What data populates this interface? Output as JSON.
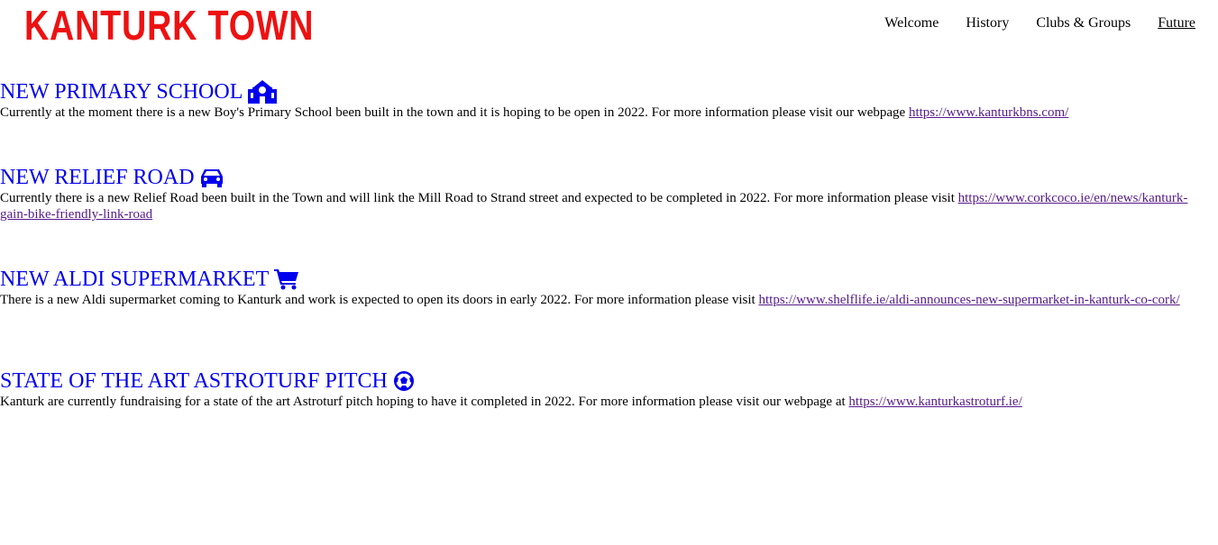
{
  "header": {
    "logo": "KANTURK TOWN",
    "nav": [
      {
        "label": "Welcome"
      },
      {
        "label": "History"
      },
      {
        "label": "Clubs & Groups"
      },
      {
        "label": "Future"
      }
    ]
  },
  "sections": [
    {
      "title": "NEW PRIMARY SCHOOL",
      "icon": "school-icon",
      "text": "Currently at the moment there is a new Boy's Primary School been built in the town and it is hoping to be open in 2022. For more information please visit our webpage ",
      "link": "https://www.kanturkbns.com/"
    },
    {
      "title": "NEW RELIEF ROAD",
      "icon": "car-icon",
      "text": "Currently there is a new Relief Road been built in the Town and will link the Mill Road to Strand street and expected to be completed in 2022. For more information please visit ",
      "link": "https://www.corkcoco.ie/en/news/kanturk-gain-bike-friendly-link-road"
    },
    {
      "title": "NEW ALDI SUPERMARKET",
      "icon": "shopping-cart-icon",
      "text": "There is a new Aldi supermarket coming to Kanturk and work is expected to open its doors in early 2022. For more information please visit ",
      "link": "https://www.shelflife.ie/aldi-announces-new-supermarket-in-kanturk-co-cork/"
    },
    {
      "title": "STATE OF THE ART ASTROTURF PITCH",
      "icon": "football-icon",
      "text": "Kanturk are currently fundraising for a state of the art Astroturf pitch hoping to have it completed in 2022. For more information please visit our webpage at ",
      "link": "https://www.kanturkastroturf.ie/"
    }
  ],
  "colors": {
    "logo": "#ee1111",
    "heading": "#0000ee",
    "link": "#551a8b"
  }
}
